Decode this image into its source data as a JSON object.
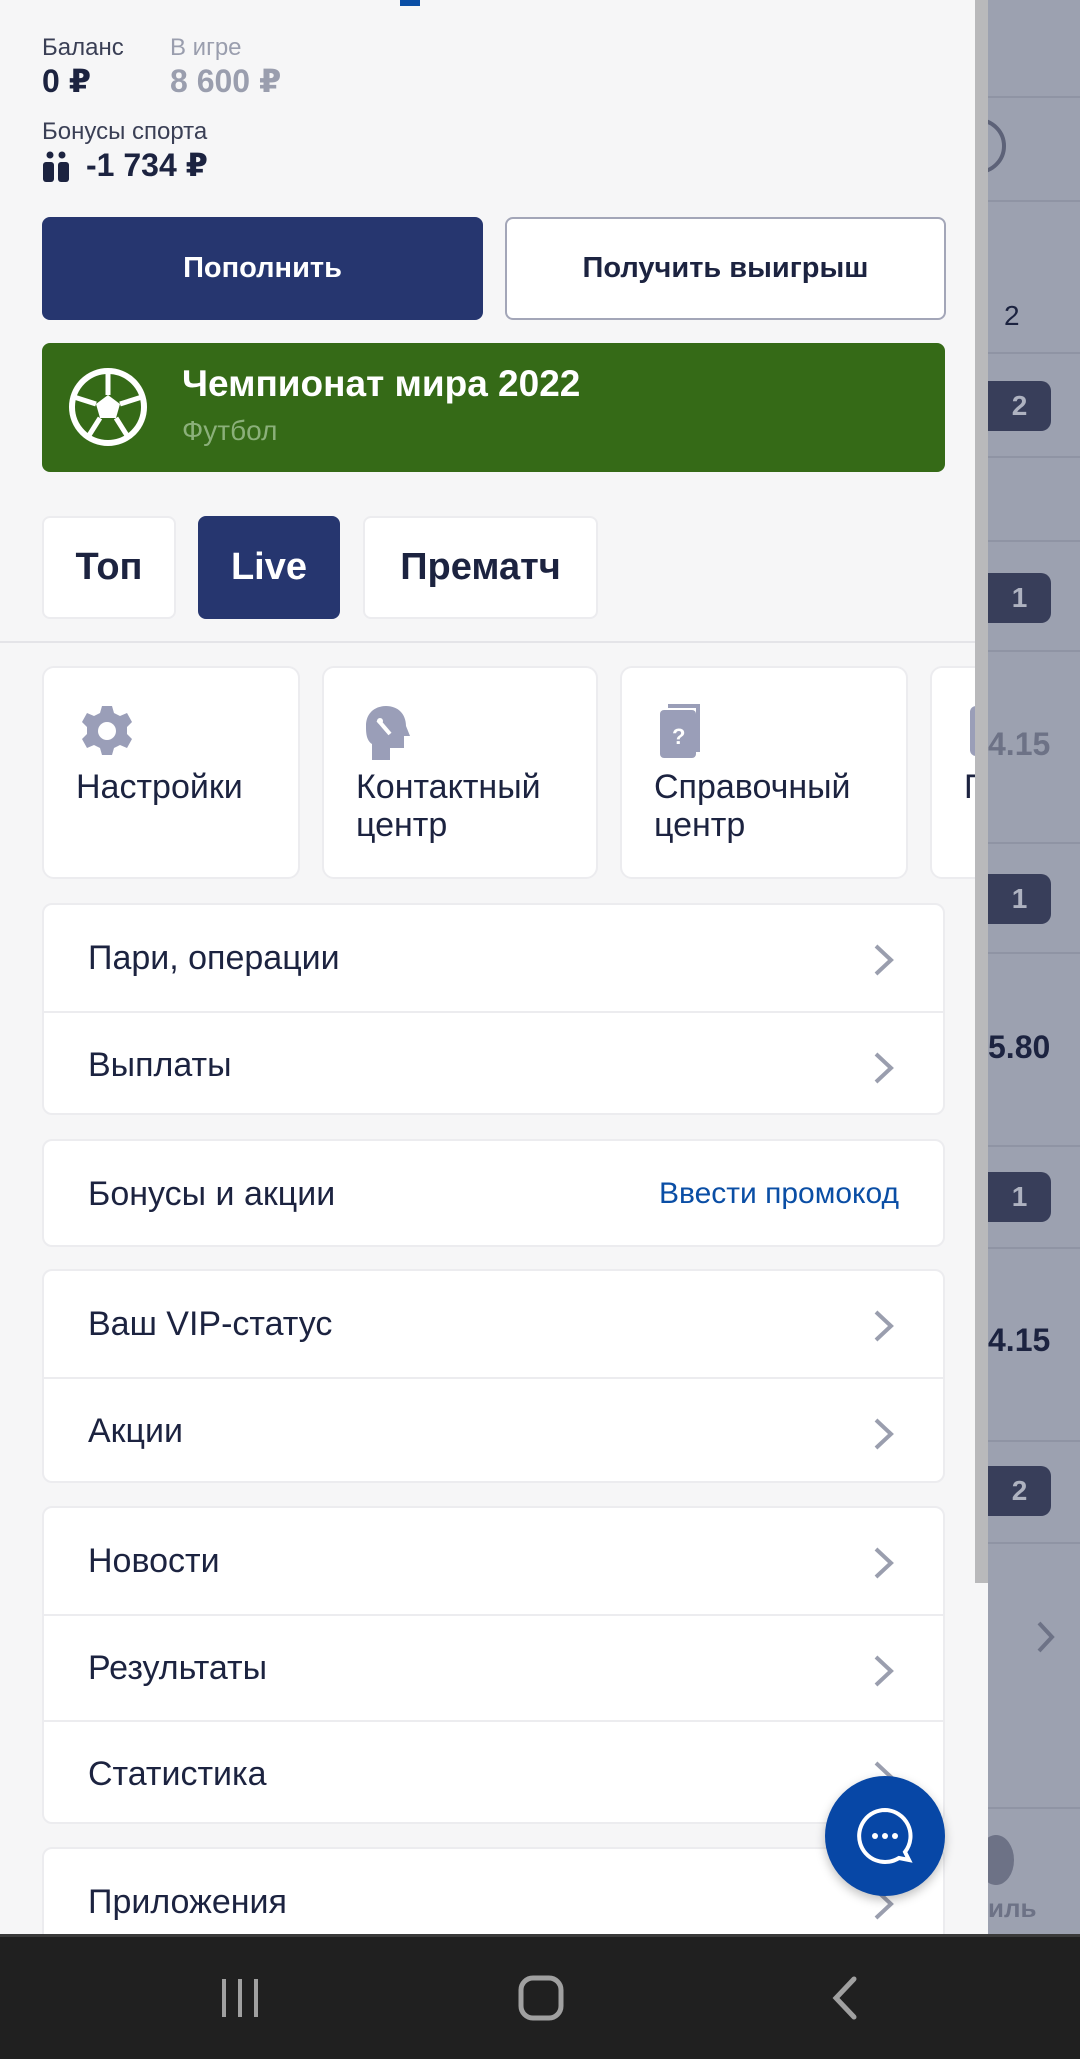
{
  "background": {
    "badges": [
      "2",
      "1",
      "1",
      "1",
      "2"
    ],
    "numbers": [
      "2",
      "4.15",
      "5.80",
      "4.15"
    ],
    "nav_label_fragment": "иль"
  },
  "balance": {
    "balance_label": "Баланс",
    "balance_value": "0 ₽",
    "in_game_label": "В игре",
    "in_game_value": "8 600 ₽",
    "sport_bonus_label": "Бонусы спорта",
    "sport_bonus_value": "-1 734 ₽"
  },
  "actions": {
    "deposit": "Пополнить",
    "withdraw": "Получить выигрыш"
  },
  "banner": {
    "title": "Чемпионат мира 2022",
    "subtitle": "Футбол",
    "color": "#356a17"
  },
  "tabs": [
    {
      "label": "Топ",
      "active": false
    },
    {
      "label": "Live",
      "active": true
    },
    {
      "label": "Прематч",
      "active": false
    }
  ],
  "quick_cards": [
    {
      "label": "Настройки",
      "icon": "gear-icon"
    },
    {
      "label": "Контактный центр",
      "icon": "headset-head-icon"
    },
    {
      "label": "Справочный центр",
      "icon": "help-book-icon"
    },
    {
      "label": "П",
      "icon": "phone-icon"
    }
  ],
  "menu": {
    "group1": [
      "Пари, операции",
      "Выплаты"
    ],
    "bonuses": {
      "label": "Бонусы и акции",
      "link": "Ввести промокод"
    },
    "group3": [
      "Ваш VIP-статус",
      "Акции"
    ],
    "group4": [
      "Новости",
      "Результаты",
      "Статистика"
    ],
    "group5": [
      "Приложения"
    ]
  },
  "colors": {
    "primary": "#26366f",
    "link": "#0a4ea5",
    "fab": "#0747a6"
  }
}
